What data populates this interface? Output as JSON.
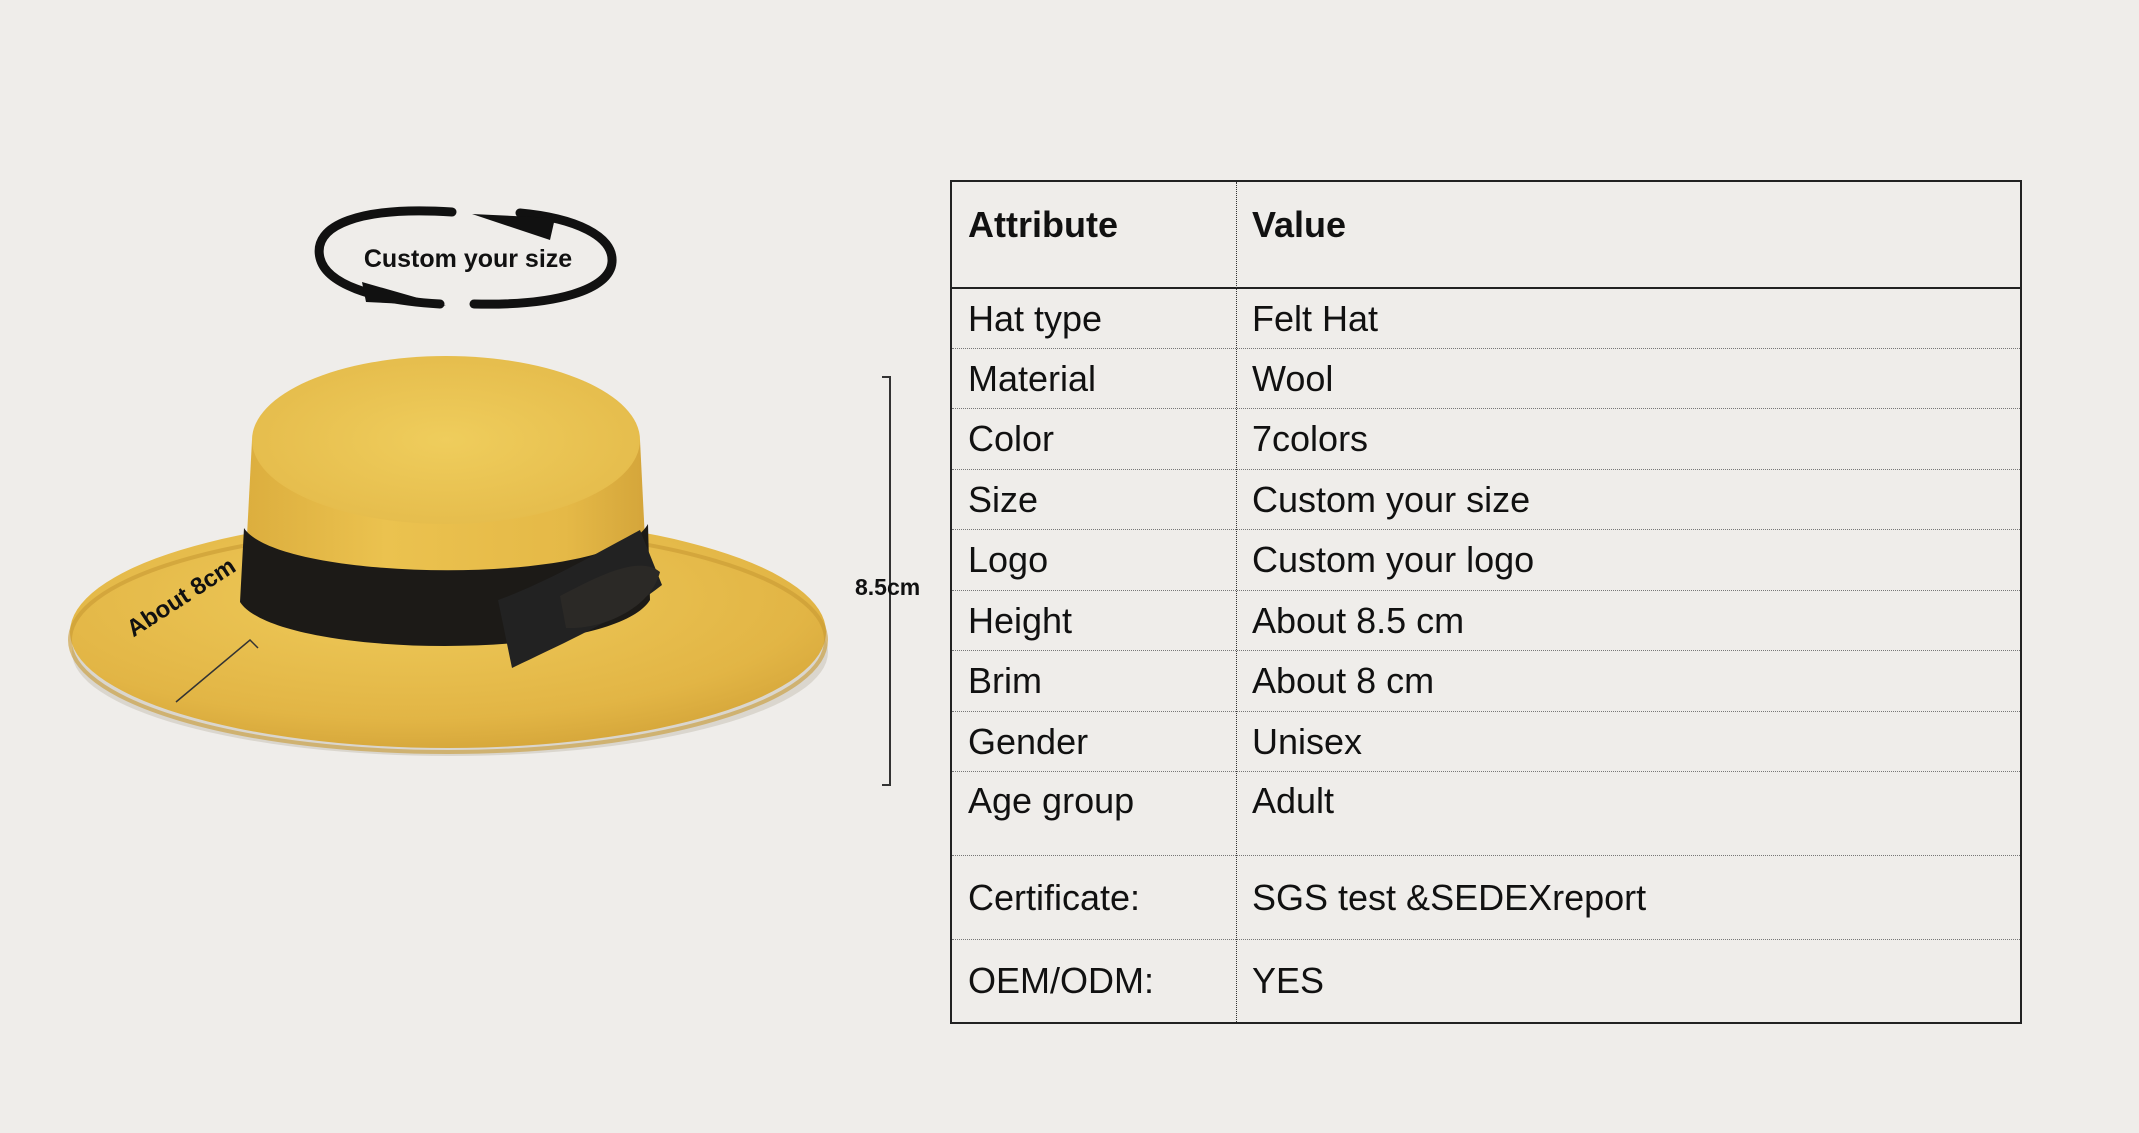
{
  "illustration": {
    "custom_size_caption": "Custom your size",
    "height_label": "8.5cm",
    "brim_label": "About  8cm"
  },
  "table": {
    "headers": [
      "Attribute",
      "Value"
    ],
    "rows": [
      {
        "attribute": "Hat type",
        "value": "Felt Hat"
      },
      {
        "attribute": "Material",
        "value": "Wool"
      },
      {
        "attribute": "Color",
        "value": "7colors"
      },
      {
        "attribute": "Size",
        "value": "Custom your size"
      },
      {
        "attribute": "Logo",
        "value": "Custom your logo"
      },
      {
        "attribute": "Height",
        "value": "About 8.5 cm"
      },
      {
        "attribute": "Brim",
        "value": "About 8 cm"
      },
      {
        "attribute": "Gender",
        "value": "Unisex"
      },
      {
        "attribute": "Age group",
        "value": "Adult"
      },
      {
        "attribute": "Certificate:",
        "value": "SGS test &SEDEXreport"
      },
      {
        "attribute": "OEM/ODM:",
        "value": "YES"
      }
    ]
  },
  "colors": {
    "background": "#efedea",
    "hat_felt": "#e6bd4a",
    "hat_band": "#1c1a17"
  }
}
